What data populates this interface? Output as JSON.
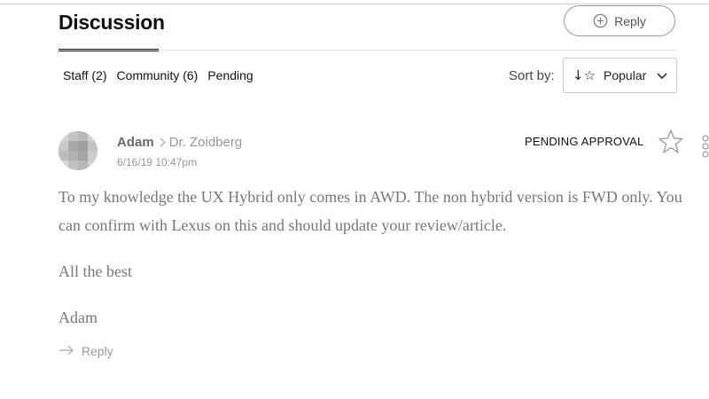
{
  "header": {
    "title": "Discussion",
    "reply_label": "Reply"
  },
  "filters": {
    "staff": "Staff (2)",
    "community": "Community (6)",
    "pending": "Pending"
  },
  "sort": {
    "label": "Sort by:",
    "selected": "Popular",
    "icon": "sort-arrow-star-icon"
  },
  "comment": {
    "author": "Adam",
    "reply_to": "Dr. Zoidberg",
    "timestamp": "6/16/19 10:47pm",
    "status": "PENDING APPROVAL",
    "paragraphs": [
      "To my knowledge the UX Hybrid only comes in AWD. The non hybrid version is FWD only. You can confirm with Lexus on this and should update your review/article.",
      "All the best",
      "Adam"
    ],
    "reply_label": "Reply"
  },
  "colors": {
    "accent": "#111111",
    "muted_text": "#777777",
    "border": "#c8c8c8"
  }
}
